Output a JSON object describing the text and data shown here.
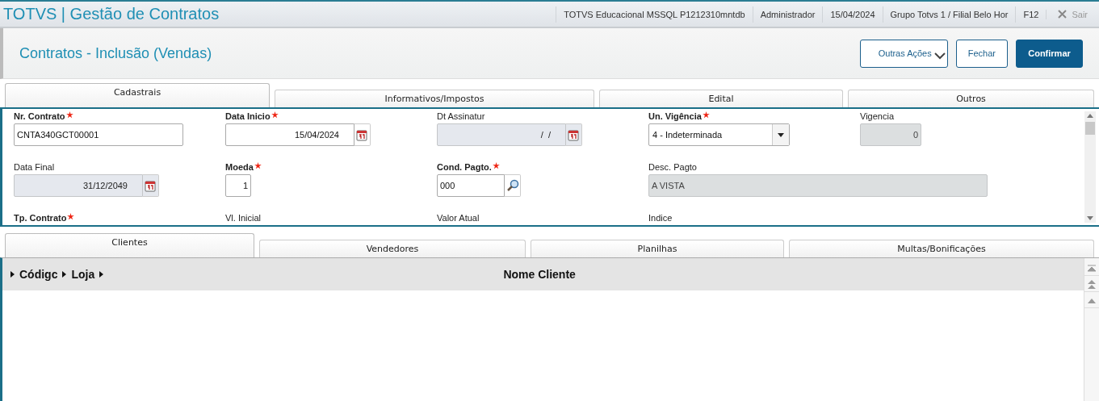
{
  "app_title": "TOTVS | Gestão de Contratos",
  "status_items": [
    "TOTVS Educacional MSSQL P1212310mntdb",
    "Administrador",
    "15/04/2024",
    "Grupo Totvs 1 / Filial Belo Hor",
    "F12"
  ],
  "exit": {
    "label": "Sair",
    "disabled": true
  },
  "page_title": "Contratos - Inclusão (Vendas)",
  "actions": [
    {
      "label": "Outras Ações",
      "kind": "menu"
    },
    {
      "label": "Fechar",
      "kind": "secondary"
    },
    {
      "label": "Confirmar",
      "kind": "primary"
    }
  ],
  "form_tabs": [
    {
      "label": "Cadastrais",
      "selected": true
    },
    {
      "label": "Informativos/Impostos",
      "selected": false
    },
    {
      "label": "Edital",
      "selected": false
    },
    {
      "label": "Outros",
      "selected": false
    }
  ],
  "fields": [
    {
      "label": "Nr. Contrato",
      "required": true,
      "kind": "text",
      "value": "CNTA340GCT00001",
      "disabled": false
    },
    {
      "label": "Data Inicio",
      "required": true,
      "kind": "date",
      "value": "15/04/2024",
      "disabled": false
    },
    {
      "label": "Dt Assinatur",
      "required": false,
      "kind": "date",
      "value": " /  /",
      "disabled": true
    },
    {
      "label": "Un. Vigência",
      "required": true,
      "kind": "select",
      "value": "4 - Indeterminada",
      "disabled": false
    },
    {
      "label": "Vigencia",
      "required": false,
      "kind": "number",
      "value": "0",
      "disabled": true
    },
    {
      "label": "Data Final",
      "required": false,
      "kind": "date",
      "value": "31/12/2049",
      "disabled": true
    },
    {
      "label": "Moeda",
      "required": true,
      "kind": "number",
      "value": "1",
      "disabled": false
    },
    {
      "label": "Cond. Pagto.",
      "required": true,
      "kind": "lookup",
      "value": "000",
      "disabled": false
    },
    {
      "label": "Desc. Pagto",
      "required": false,
      "kind": "wide",
      "value": "A VISTA",
      "disabled": true
    },
    {
      "label": "Tp. Contrato",
      "required": true,
      "kind": "label"
    },
    {
      "label": "Vl. Inicial",
      "required": false,
      "kind": "label"
    },
    {
      "label": "Valor Atual",
      "required": false,
      "kind": "label"
    },
    {
      "label": "Indice",
      "required": false,
      "kind": "label"
    }
  ],
  "grid_tabs": [
    {
      "label": "Clientes",
      "selected": true
    },
    {
      "label": "Vendedores",
      "selected": false
    },
    {
      "label": "Planilhas",
      "selected": false
    },
    {
      "label": "Multas/Bonificações",
      "selected": false
    }
  ],
  "grid_columns": [
    {
      "label": "Códigc",
      "kind": "narrow"
    },
    {
      "label": "Loja",
      "kind": "narrow"
    },
    {
      "label": "Nome Cliente",
      "kind": "wide"
    }
  ]
}
